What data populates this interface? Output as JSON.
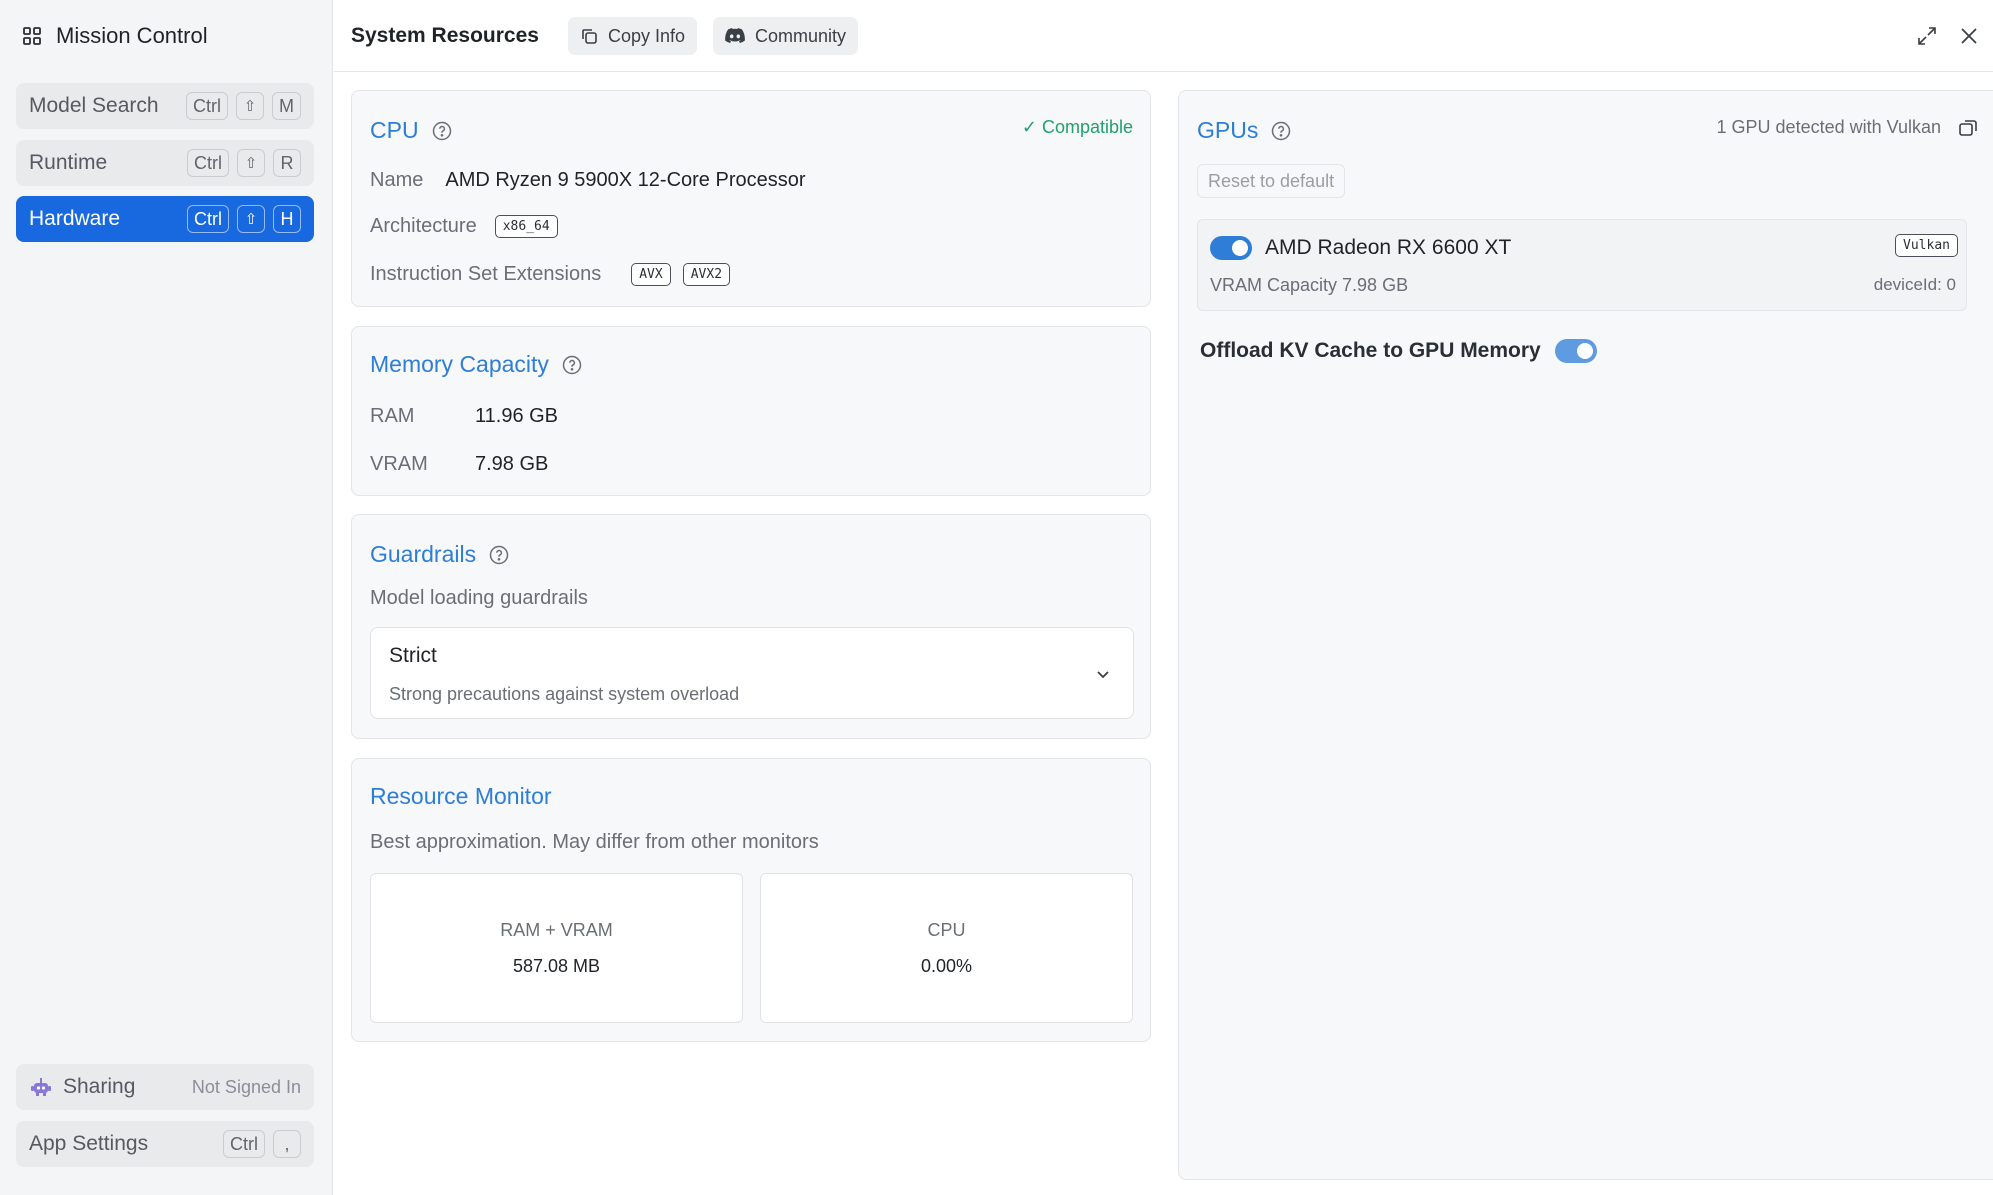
{
  "sidebar": {
    "title": "Mission Control",
    "items": [
      {
        "label": "Model Search",
        "keys": [
          "Ctrl",
          "⇧",
          "M"
        ]
      },
      {
        "label": "Runtime",
        "keys": [
          "Ctrl",
          "⇧",
          "R"
        ]
      },
      {
        "label": "Hardware",
        "keys": [
          "Ctrl",
          "⇧",
          "H"
        ]
      }
    ],
    "sharing": {
      "label": "Sharing",
      "status": "Not Signed In"
    },
    "settings": {
      "label": "App Settings",
      "keys": [
        "Ctrl",
        ","
      ]
    }
  },
  "header": {
    "title": "System Resources",
    "copy_label": "Copy Info",
    "community_label": "Community"
  },
  "cpu": {
    "title": "CPU",
    "status": "✓ Compatible",
    "name_label": "Name",
    "name_value": "AMD Ryzen 9 5900X 12-Core Processor",
    "arch_label": "Architecture",
    "arch_value": "x86_64",
    "ext_label": "Instruction Set Extensions",
    "extensions": [
      "AVX",
      "AVX2"
    ]
  },
  "memory": {
    "title": "Memory Capacity",
    "ram_label": "RAM",
    "ram_value": "11.96 GB",
    "vram_label": "VRAM",
    "vram_value": "7.98 GB"
  },
  "guardrails": {
    "title": "Guardrails",
    "subtitle": "Model loading guardrails",
    "selected": "Strict",
    "selected_desc": "Strong precautions against system overload"
  },
  "monitor": {
    "title": "Resource Monitor",
    "subtitle": "Best approximation. May differ from other monitors",
    "ram_vram_label": "RAM + VRAM",
    "ram_vram_value": "587.08 MB",
    "cpu_label": "CPU",
    "cpu_value": "0.00%"
  },
  "gpus": {
    "title": "GPUs",
    "detected": "1 GPU detected with Vulkan",
    "reset_label": "Reset to default",
    "gpu_name": "AMD Radeon RX 6600 XT",
    "gpu_backend": "Vulkan",
    "vram_capacity": "VRAM Capacity 7.98 GB",
    "device_id": "deviceId: 0",
    "gpu_enabled": true,
    "offload_label": "Offload KV Cache to GPU Memory",
    "offload_enabled": true
  },
  "colors": {
    "accent": "#2e7dd6",
    "active_nav": "#1868e0",
    "compatible": "#22a06b"
  }
}
